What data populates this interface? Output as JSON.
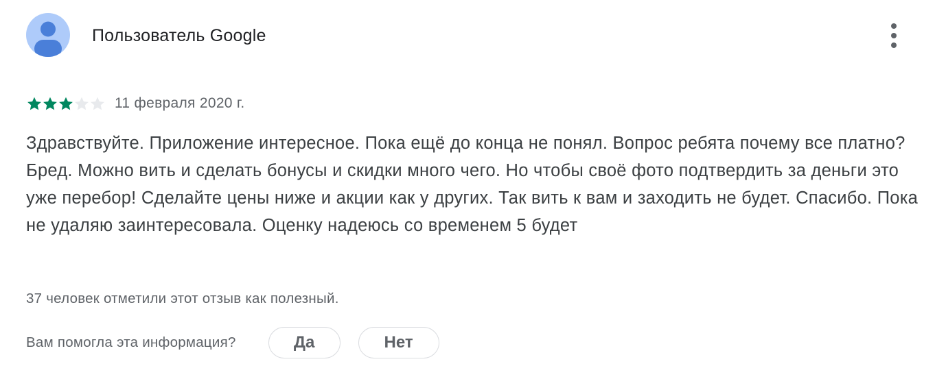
{
  "review": {
    "author": "Пользователь Google",
    "rating": 3,
    "rating_max": 5,
    "date": "11 февраля 2020 г.",
    "text": "Здравствуйте. Приложение интересное. Пока ещё до конца не понял. Вопрос ребята почему все платно? Бред. Можно вить и сделать бонусы и скидки много чего. Но чтобы своё фото подтвердить за деньги это уже перебор! Сделайте цены ниже и акции как у других. Так вить к вам и заходить не будет. Спасибо. Пока не удаляю заинтересовала. Оценку надеюсь со временем 5 будет",
    "helpful_count_text": "37 человек отметили этот отзыв как полезный.",
    "feedback": {
      "question": "Вам помогла эта информация?",
      "yes_label": "Да",
      "no_label": "Нет"
    }
  },
  "icons": {
    "avatar": "person-avatar-icon",
    "more": "more-vert-icon",
    "star_filled": "star-filled-icon",
    "star_empty": "star-empty-icon"
  },
  "colors": {
    "star_filled": "#01875f",
    "star_empty": "#e8eaed",
    "avatar_bg": "#aecbfa",
    "avatar_figure": "#4a7fd9",
    "button_border": "#dadce0",
    "secondary_text": "#5f6368"
  }
}
